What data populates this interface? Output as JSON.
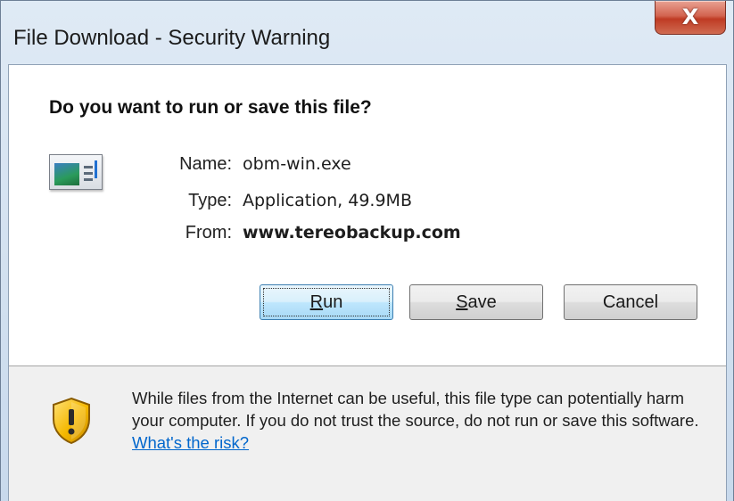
{
  "window": {
    "title": "File Download - Security Warning",
    "close_glyph": "X"
  },
  "dialog": {
    "question": "Do you want to run or save this file?",
    "file_icon": "application-file-icon",
    "name_label": "Name:",
    "name_value": "obm-win.exe",
    "type_label": "Type:",
    "type_value": "Application, 49.9MB",
    "from_label": "From:",
    "from_value": "www.tereobackup.com"
  },
  "buttons": {
    "run": {
      "label_u": "R",
      "label_rest": "un"
    },
    "save": {
      "label_u": "S",
      "label_rest": "ave"
    },
    "cancel": {
      "label": "Cancel"
    }
  },
  "warning": {
    "icon": "security-shield-icon",
    "text": "While files from the Internet can be useful, this file type can potentially harm your computer. If you do not trust the source, do not run or save this software. ",
    "link_text": "What's the risk?"
  },
  "colors": {
    "link": "#0066cc",
    "default_button_border": "#3c7fb1",
    "close_button": "#c7432c",
    "shield": "#f5b800"
  }
}
